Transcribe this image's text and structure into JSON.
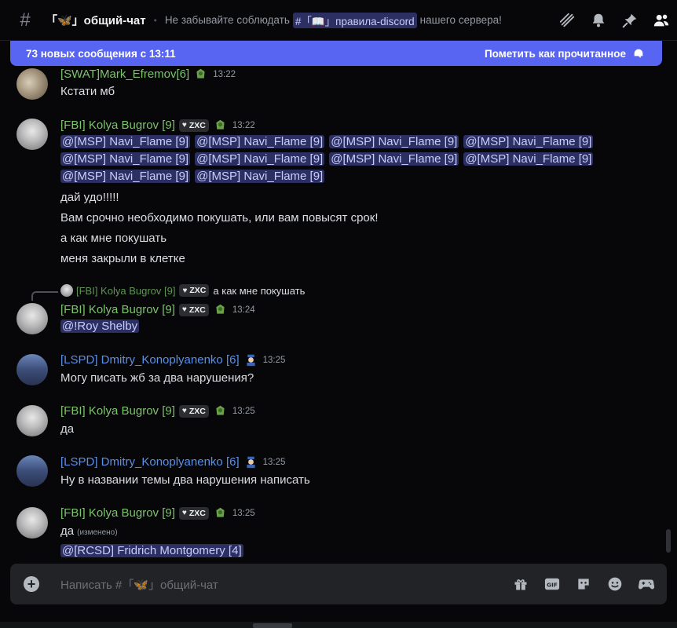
{
  "header": {
    "channel_name": "「🦋」общий-чат",
    "topic_before": "Не забывайте соблюдать",
    "topic_channel": "#「📖」правила-discord",
    "topic_after": "нашего сервера!",
    "icons": [
      "threads-icon",
      "bell-icon",
      "pin-icon",
      "members-icon"
    ]
  },
  "new_bar": {
    "text": "73 новых сообщения с 13:11",
    "mark_read": "Пометить как прочитанное"
  },
  "messages": [
    {
      "author": "[SWAT]Mark_Efremov[6]",
      "time": "13:22",
      "lines": [
        "Кстати мб"
      ]
    },
    {
      "author": "[FBI] Kolya Bugrov [9]",
      "tag": "ZXC",
      "time": "13:22",
      "mentions": [
        "@[MSP] Navi_Flame [9]",
        "@[MSP] Navi_Flame [9]",
        "@[MSP] Navi_Flame [9]",
        "@[MSP] Navi_Flame [9]",
        "@[MSP] Navi_Flame [9]",
        "@[MSP] Navi_Flame [9]",
        "@[MSP] Navi_Flame [9]",
        "@[MSP] Navi_Flame [9]",
        "@[MSP] Navi_Flame [9]",
        "@[MSP] Navi_Flame [9]"
      ],
      "lines": [
        "дай удо!!!!!",
        "Вам срочно необходимо покушать, или вам повысят срок!",
        "а как мне покушать",
        "меня закрыли в клетке"
      ]
    },
    {
      "reply_author": "[FBI] Kolya Bugrov [9]",
      "reply_tag": "ZXC",
      "reply_text": "а как мне покушать",
      "author": "[FBI] Kolya Bugrov [9]",
      "tag": "ZXC",
      "time": "13:24",
      "mention": "@!Roy Shelby"
    },
    {
      "author": "[LSPD] Dmitry_Konoplyanenko [6]",
      "time": "13:25",
      "lines": [
        "Могу писать жб за два нарушения?"
      ]
    },
    {
      "author": "[FBI] Kolya Bugrov [9]",
      "tag": "ZXC",
      "time": "13:25",
      "lines": [
        "да"
      ]
    },
    {
      "author": "[LSPD] Dmitry_Konoplyanenko [6]",
      "time": "13:25",
      "lines": [
        "Ну в названии темы два нарушения написать"
      ]
    },
    {
      "author": "[FBI] Kolya Bugrov [9]",
      "tag": "ZXC",
      "time": "13:25",
      "lines": [
        "да"
      ],
      "edited": "(изменено)",
      "mention": "@[RCSD] Fridrich Montgomery [4]"
    }
  ],
  "composer": {
    "placeholder": "Написать #「🦋」общий-чат",
    "icons": [
      "gift-icon",
      "gif-icon",
      "sticker-icon",
      "emoji-icon",
      "activities-icon"
    ]
  }
}
